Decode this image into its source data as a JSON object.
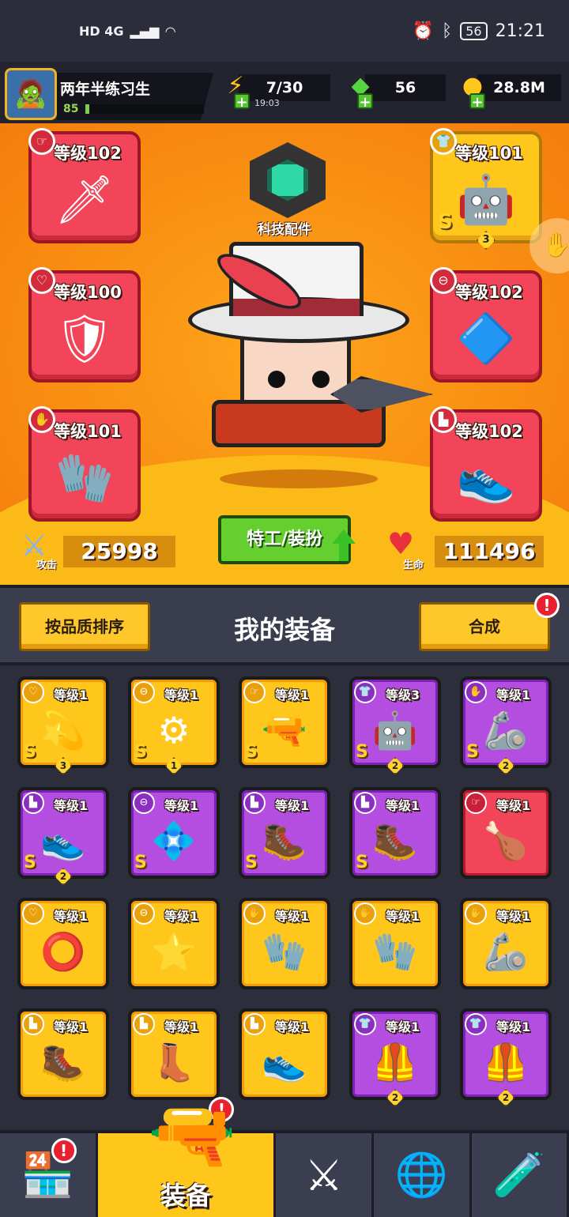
{
  "status_bar": {
    "network": "HD 4G",
    "battery": "56",
    "time": "21:21"
  },
  "player": {
    "name": "两年半练习生",
    "level": "85",
    "xp_fraction": 0.03
  },
  "resources": {
    "energy": "7/30",
    "energy_timer": "19:03",
    "gems": "56",
    "coins": "28.8M"
  },
  "hero": {
    "tech_label": "科技配件",
    "agent_button": "特工/装扮",
    "attack_value": "25998",
    "attack_label": "攻击",
    "hp_value": "111496",
    "hp_label": "生命",
    "slots": [
      {
        "level": "等级102",
        "rarity": "red",
        "icon": "kunai-icon",
        "glyph": "🗡",
        "badge": "☞"
      },
      {
        "level": "等级100",
        "rarity": "red",
        "icon": "necklace-icon",
        "glyph": "🛡",
        "badge": "♡"
      },
      {
        "level": "等级101",
        "rarity": "red",
        "icon": "glove-icon",
        "glyph": "🧤",
        "badge": "✋"
      },
      {
        "level": "等级101",
        "rarity": "gold",
        "icon": "armor-icon",
        "glyph": "🤖",
        "badge": "👕",
        "s": "S",
        "stars": "3"
      },
      {
        "level": "等级102",
        "rarity": "red",
        "icon": "belt-icon",
        "glyph": "🔷",
        "badge": "⊖"
      },
      {
        "level": "等级102",
        "rarity": "red",
        "icon": "boots-icon",
        "glyph": "👟",
        "badge": "▙"
      }
    ]
  },
  "equipment": {
    "sort_button": "按品质排序",
    "title": "我的装备",
    "merge_button": "合成",
    "merge_alert": "!",
    "items": [
      {
        "level": "等级1",
        "rarity": "gold",
        "icon": "star-necklace-icon",
        "glyph": "💫",
        "badge": "♡",
        "s": "S",
        "stars": "3"
      },
      {
        "level": "等级1",
        "rarity": "gold",
        "icon": "belt-icon",
        "glyph": "⚙",
        "badge": "⊖",
        "s": "S",
        "stars": "1"
      },
      {
        "level": "等级1",
        "rarity": "gold",
        "icon": "blaster-icon",
        "glyph": "🔫",
        "badge": "☞",
        "s": "S",
        "stars": ""
      },
      {
        "level": "等级3",
        "rarity": "purple",
        "icon": "armor-icon",
        "glyph": "🤖",
        "badge": "👕",
        "s": "S",
        "stars": "2"
      },
      {
        "level": "等级1",
        "rarity": "purple",
        "icon": "glove-icon",
        "glyph": "🦾",
        "badge": "✋",
        "s": "S",
        "stars": "2"
      },
      {
        "level": "等级1",
        "rarity": "purple",
        "icon": "boots-icon",
        "glyph": "👟",
        "badge": "▙",
        "s": "S",
        "stars": "2"
      },
      {
        "level": "等级1",
        "rarity": "purple",
        "icon": "belt-icon",
        "glyph": "💠",
        "badge": "⊖",
        "s": "S",
        "stars": ""
      },
      {
        "level": "等级1",
        "rarity": "purple",
        "icon": "boots-icon",
        "glyph": "🥾",
        "badge": "▙",
        "s": "S",
        "stars": ""
      },
      {
        "level": "等级1",
        "rarity": "purple",
        "icon": "boots-icon",
        "glyph": "🥾",
        "badge": "▙",
        "s": "S",
        "stars": ""
      },
      {
        "level": "等级1",
        "rarity": "red",
        "icon": "drumstick-icon",
        "glyph": "🍗",
        "badge": "☞",
        "s": "",
        "stars": ""
      },
      {
        "level": "等级1",
        "rarity": "gold",
        "icon": "spiked-collar-icon",
        "glyph": "⭕",
        "badge": "♡",
        "s": "",
        "stars": ""
      },
      {
        "level": "等级1",
        "rarity": "gold",
        "icon": "belt-icon",
        "glyph": "⭐",
        "badge": "⊖",
        "s": "",
        "stars": ""
      },
      {
        "level": "等级1",
        "rarity": "gold",
        "icon": "claw-glove-icon",
        "glyph": "🧤",
        "badge": "✋",
        "s": "",
        "stars": ""
      },
      {
        "level": "等级1",
        "rarity": "gold",
        "icon": "glove-icon",
        "glyph": "🧤",
        "badge": "✋",
        "s": "",
        "stars": ""
      },
      {
        "level": "等级1",
        "rarity": "gold",
        "icon": "glove-icon",
        "glyph": "🦾",
        "badge": "✋",
        "s": "",
        "stars": ""
      },
      {
        "level": "等级1",
        "rarity": "gold",
        "icon": "boots-icon",
        "glyph": "🥾",
        "badge": "▙",
        "s": "",
        "stars": ""
      },
      {
        "level": "等级1",
        "rarity": "gold",
        "icon": "boots-icon",
        "glyph": "👢",
        "badge": "▙",
        "s": "",
        "stars": ""
      },
      {
        "level": "等级1",
        "rarity": "gold",
        "icon": "boots-icon",
        "glyph": "👟",
        "badge": "▙",
        "s": "",
        "stars": ""
      },
      {
        "level": "等级1",
        "rarity": "purple",
        "icon": "armor-icon",
        "glyph": "🦺",
        "badge": "👕",
        "s": "",
        "stars": "2"
      },
      {
        "level": "等级1",
        "rarity": "purple",
        "icon": "armor-icon",
        "glyph": "🦺",
        "badge": "👕",
        "s": "",
        "stars": "2"
      }
    ]
  },
  "nav": {
    "active_label": "装备",
    "tabs": [
      {
        "icon": "shop-icon",
        "glyph": "🏪",
        "alert": "!"
      },
      {
        "icon": "equipment-revolver-icon",
        "glyph": "",
        "alert": "!"
      },
      {
        "icon": "battle-icon",
        "glyph": "⚔",
        "alert": ""
      },
      {
        "icon": "world-icon",
        "glyph": "🌐",
        "alert": ""
      },
      {
        "icon": "lab-icon",
        "glyph": "🧪",
        "alert": ""
      }
    ]
  }
}
